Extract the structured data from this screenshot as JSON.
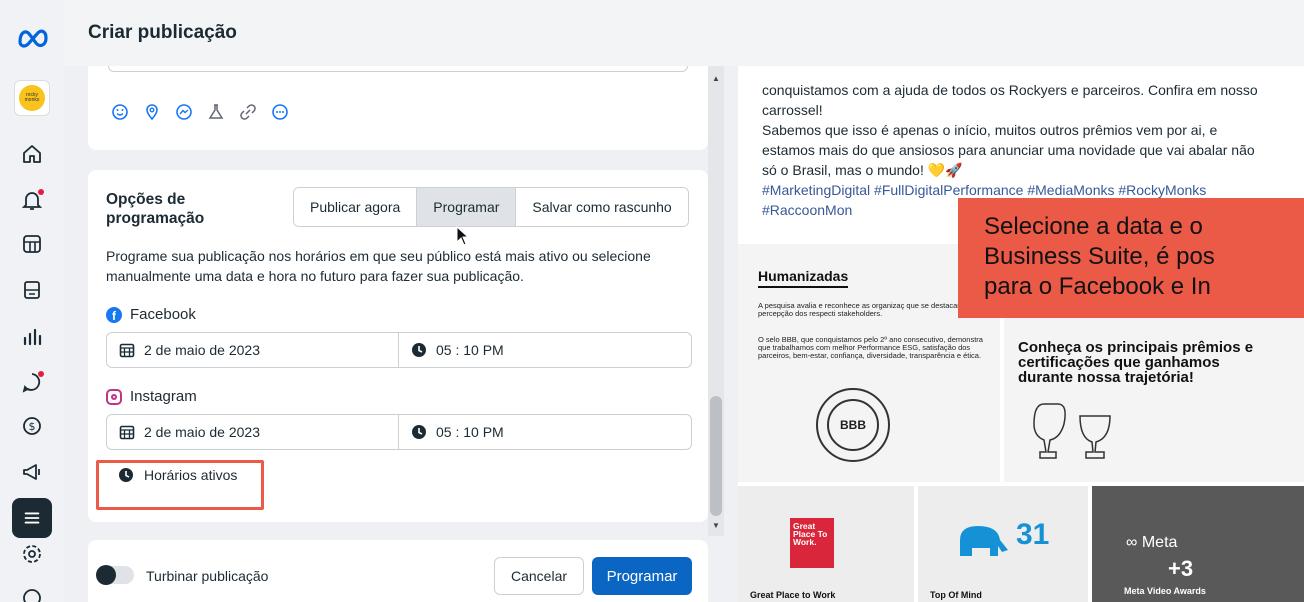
{
  "header": {
    "title": "Criar publicação"
  },
  "rail": {
    "avatar_text": "rocky monks",
    "icons": [
      "home-icon",
      "notifications-icon",
      "content-icon",
      "planner-icon",
      "insights-icon",
      "inbox-icon",
      "monetization-icon",
      "ads-icon",
      "menu-icon",
      "settings-icon",
      "help-icon"
    ]
  },
  "composer": {
    "toolbar_icons": [
      "emoji-icon",
      "location-icon",
      "messenger-icon",
      "lab-icon",
      "link-icon",
      "more-icon"
    ]
  },
  "scheduling": {
    "title": "Opções de programação",
    "options": [
      "Publicar agora",
      "Programar",
      "Salvar como rascunho"
    ],
    "selected_option": "Programar",
    "description": "Programe sua publicação nos horários em que seu público está mais ativo ou selecione manualmente uma data e hora no futuro para fazer sua publicação.",
    "facebook": {
      "label": "Facebook",
      "date": "2 de maio de 2023",
      "time": "05 : 10 PM"
    },
    "instagram": {
      "label": "Instagram",
      "date": "2 de maio de 2023",
      "time": "05 : 10 PM"
    },
    "active_hours_label": "Horários ativos",
    "highlight_color": "#ea5a47"
  },
  "footer": {
    "boost_label": "Turbinar publicação",
    "cancel_label": "Cancelar",
    "submit_label": "Programar",
    "primary_color": "#0a66c2"
  },
  "preview": {
    "caption_line1": "conquistamos com a ajuda de todos os Rockyers e parceiros. Confira em nosso carrossel!",
    "caption_line2": "Sabemos que isso é apenas o início, muitos outros prêmios vem por ai, e estamos mais do que ansiosos para anunciar uma novidade que vai abalar não só o Brasil, mas o mundo! 💛🚀",
    "hashtags": "#MarketingDigital #FullDigitalPerformance #MediaMonks #RockyMonks #RaccoonMon",
    "tile1_title": "Humanizadas",
    "tile1_text1": "A pesquisa avalia e reconhece as organizaç que se destacam na percepção dos respecti stakeholders.",
    "tile1_text2": "O selo BBB, que conquistamos pelo 2º ano consecutivo, demonstra que trabalhamos com melhor Performance ESG, satisfação dos parceiros, bem-estar, confiança, diversidade, transparência e ética.",
    "bbb_label": "BBB",
    "tile2_text": "Conheça os principais prêmios e certificações que ganhamos durante nossa trajetória!",
    "gptw_text": "Great Place To Work.",
    "gptw_caption": "Great Place to Work",
    "tom_number": "31",
    "tom_caption": "Top Of Mind",
    "meta_logo": "∞ Meta",
    "meta_plus": "+3",
    "meta_caption": "Meta Video Awards"
  },
  "overlay": {
    "text": "Selecione a data e o\nBusiness Suite, é pos\npara o Facebook e In",
    "color": "#ea5a47"
  }
}
